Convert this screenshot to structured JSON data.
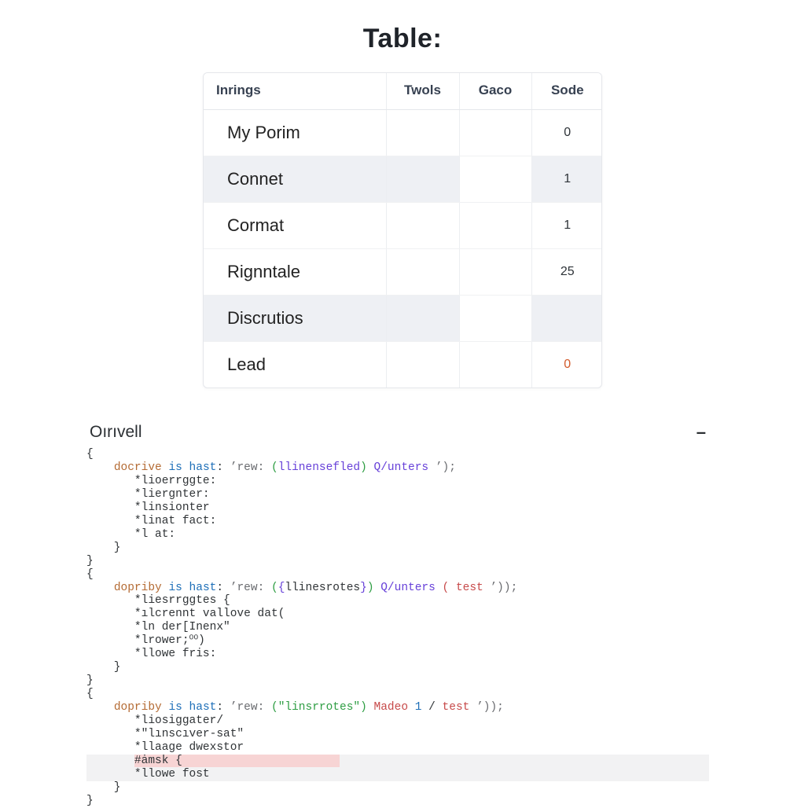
{
  "title": "Table:",
  "table": {
    "headers": [
      "Inrings",
      "Twols",
      "Gaco",
      "Sode"
    ],
    "rows": [
      {
        "cells": [
          "My Porim",
          "",
          "",
          "0"
        ],
        "alt": false,
        "sode_warn": false
      },
      {
        "cells": [
          "Connet",
          "",
          "",
          "1"
        ],
        "alt": true,
        "sode_warn": false
      },
      {
        "cells": [
          "Cormat",
          "",
          "",
          "1"
        ],
        "alt": false,
        "sode_warn": false
      },
      {
        "cells": [
          "Rignntale",
          "",
          "",
          "25"
        ],
        "alt": false,
        "sode_warn": false
      },
      {
        "cells": [
          "Discrutios",
          "",
          "",
          ""
        ],
        "alt": true,
        "sode_warn": false
      },
      {
        "cells": [
          "Lead",
          "",
          "",
          "0"
        ],
        "alt": false,
        "sode_warn": true
      }
    ]
  },
  "panel": {
    "title": "Oırıvell",
    "toggle": "–"
  },
  "code": {
    "block1": {
      "head_key": "docrive",
      "head_mid": "is hast",
      "head_str_a": "’rew:",
      "head_paren1a": "(",
      "head_paren2": "llinensefled",
      "head_paren1b": ")",
      "head_tail": "Q/unters",
      "head_str_b": "’);",
      "lines": [
        "*lioerrggte:",
        "*liergnter:",
        "*linsionter",
        "*linat fact:",
        "*l at:"
      ]
    },
    "block2": {
      "head_key": "dopriby",
      "head_mid": "is hast",
      "head_str_a": "’rew:",
      "head_paren1a": "(",
      "head_paren2a": "{",
      "head_paren2_text": "llinesrotes",
      "head_paren2b": "}",
      "head_paren1b": ")",
      "head_tail": "Q/unters",
      "head_paren_open": "(",
      "head_test": "test",
      "head_str_b": "’));",
      "lines": [
        "*liesrrggtes {",
        "*ılcrennt vallove dat(",
        "*ln der[Inenx\"",
        "*lrower;⁰⁰)",
        "*llowe fris:"
      ]
    },
    "block3": {
      "head_key": "dopriby",
      "head_mid": "is hast",
      "head_str_a": "’rew:",
      "head_paren1a": "(",
      "head_paren2_text": "\"linsrrotes\"",
      "head_paren1b": ")",
      "head_made": "Madeo",
      "head_num": "1",
      "head_slash": "/",
      "head_test": "test",
      "head_str_b": "’));",
      "lines": [
        "*liosiggater/",
        "*\"lınscıver-sat\"",
        "*llaage dwexstor",
        "#ȧmsk {",
        "*llowe fost"
      ]
    }
  }
}
